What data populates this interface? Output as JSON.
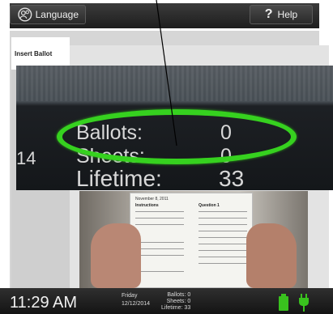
{
  "header": {
    "language_label": "Language",
    "help_label": "Help",
    "help_glyph": "?",
    "language_icon": "globe-people-icon"
  },
  "tabs": {
    "insert_ballot": "Insert Ballot"
  },
  "zoom": {
    "ballots_label": "Ballots:",
    "ballots_value": "0",
    "sheets_label": "Sheets:",
    "sheets_value": "0",
    "lifetime_label": "Lifetime:",
    "lifetime_value": "33",
    "partial_number": "14",
    "highlight_color": "#36d11f"
  },
  "photo": {
    "paper_header": "November 8, 2011",
    "paper_instructions": "Instructions",
    "paper_question": "Question 1"
  },
  "status": {
    "time": "11:29 AM",
    "day": "Friday",
    "date": "12/12/2014",
    "ballots_label": "Ballots:",
    "ballots_value": "0",
    "sheets_label": "Sheets:",
    "sheets_value": "0",
    "lifetime_label": "Lifetime:",
    "lifetime_value": "33",
    "battery_color": "#39c21e"
  }
}
